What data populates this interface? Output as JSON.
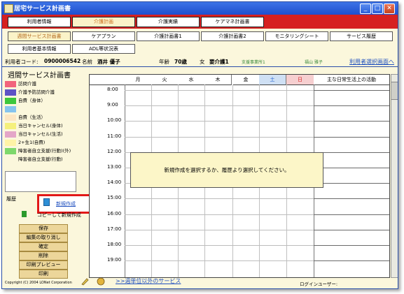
{
  "window": {
    "title": "居宅サービス計画書",
    "controls": [
      "minimize-icon",
      "maximize-icon",
      "close-icon"
    ]
  },
  "main_tabs": [
    "利用者情報",
    "介護計画",
    "介護実績",
    "ケアマネ計画書"
  ],
  "main_tabs_active": 1,
  "sub_tabs_row1": [
    "週間サービス計画書",
    "ケアプラン",
    "介護計画書1",
    "介護計画書2",
    "モニタリングシート",
    "サービス履歴"
  ],
  "sub_tabs_row2": [
    "利用者基本情報",
    "ADL等状況表"
  ],
  "sub_tabs_active": 0,
  "user_info": {
    "code_label": "利用者コード:",
    "code": "0900006542",
    "name_label": "名前",
    "name": "酒井 優子",
    "age_label": "年齢",
    "age": "70歳",
    "gender": "女",
    "care_level": "要介護1",
    "office": "支援事業所1",
    "staff": "福山 雅子",
    "select_link": "利用者選択画面へ"
  },
  "page_title": "週間サービス計画書",
  "legend": [
    {
      "label": "訪問介護",
      "color": "#f2637c"
    },
    {
      "label": "介護予防訪問介護",
      "color": "#5d52c6"
    },
    {
      "label": "自費（身体）",
      "color": "#3cc73c"
    },
    {
      "label": "",
      "color": "#86c4ee"
    },
    {
      "label": "自費（生活）",
      "color": "#fde6c2"
    },
    {
      "label": "当日キャンセル(身体)",
      "color": "#f5f07c"
    },
    {
      "label": "当日キャンセル(生活)",
      "color": "#e4a6c8"
    },
    {
      "label": "2+生1(自費)",
      "color": "#fff3a6"
    },
    {
      "label": "障害者自立支援(行動)(外)",
      "color": "#7ed86b"
    },
    {
      "label": "障害者自立支援(行動)",
      "color": "#fbf7dc"
    }
  ],
  "history_label": "履歴",
  "new_create_label": "新規作成",
  "copy_create_label": "コピーして新規作成",
  "buttons": [
    "保存",
    "編集の取り消し",
    "確定",
    "削除",
    "印刷プレビュー",
    "印刷"
  ],
  "copyright": "Copyright (C) 2004 LONet Corporation",
  "grid": {
    "days": [
      "月",
      "火",
      "水",
      "木",
      "金",
      "土",
      "日"
    ],
    "day_colors": [
      "#000000",
      "#000000",
      "#000000",
      "#000000",
      "#000000",
      "#1e5fcf",
      "#d22020"
    ],
    "day_bg_sat": "#cfe0f4",
    "day_bg_sun": "#f6cfd0",
    "activities_header": "主な日常生活上の活動",
    "times": [
      "8:00",
      "9:00",
      "10:00",
      "11:00",
      "12:00",
      "13:00",
      "14:00",
      "15:00",
      "16:00",
      "17:00",
      "18:00",
      "19:00"
    ]
  },
  "message": "新規作成を選択するか、履歴より選択してください。",
  "bottom_link": ">>週単位以外のサービス",
  "login_label": "ログインユーザー:"
}
